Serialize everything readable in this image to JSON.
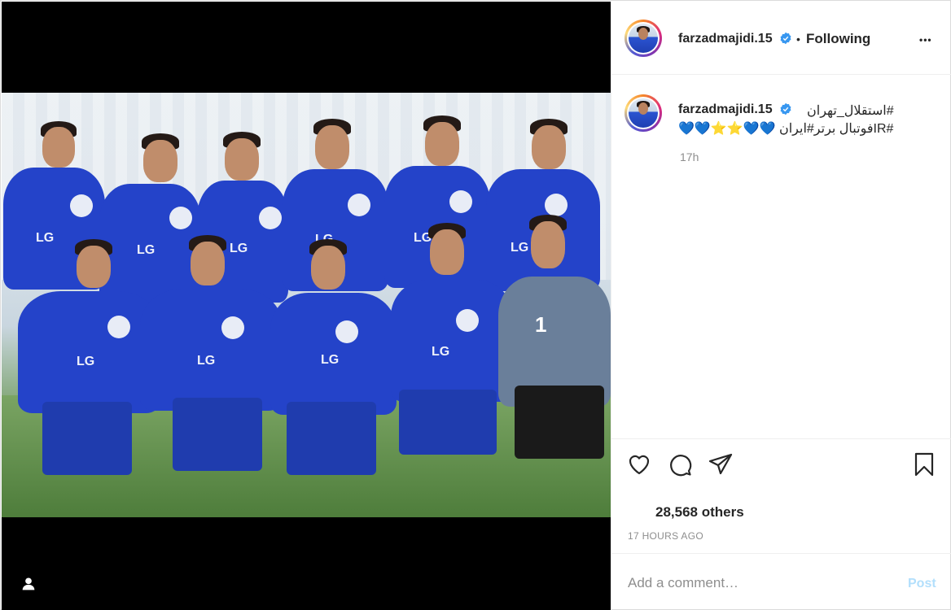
{
  "post": {
    "username": "farzadmajidi.15",
    "separator": "•",
    "follow_status": "Following",
    "more_label": "•••",
    "caption": {
      "username": "farzadmajidi.15",
      "line1": "#استقلال_تهران",
      "line2": "#IRفوتبال برتر#ایران 💙💙⭐⭐💙💙",
      "time_ago": "17h"
    },
    "likes_text": "28,568 others",
    "timestamp": "17 HOURS AGO",
    "comment": {
      "placeholder": "Add a comment…",
      "post_label": "Post"
    },
    "photo": {
      "sponsor_text": "LG",
      "keeper_number": "1"
    }
  },
  "icons": {
    "like": "heart-icon",
    "comment": "comment-icon",
    "share": "share-icon",
    "save": "bookmark-icon",
    "verified": "verified-badge-icon",
    "tagged_user": "user-tag-icon"
  },
  "colors": {
    "verified": "#3897f0",
    "post_button_disabled": "#b2dffc",
    "muted_text": "#8e8e8e",
    "jersey_blue": "#2443c9"
  }
}
